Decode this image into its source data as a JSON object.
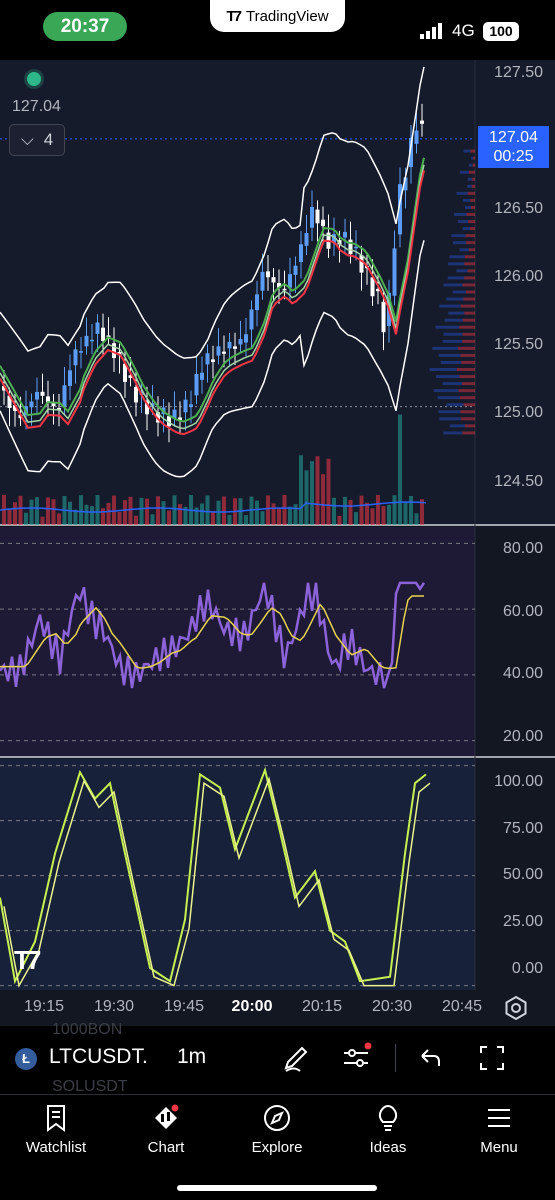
{
  "status_bar": {
    "time": "20:37",
    "app_name": "TradingView",
    "network": "4G",
    "battery": "100"
  },
  "overlay": {
    "last_value": "127.04",
    "indicator_toggle_count": "4",
    "price_tag": {
      "price": "127.04",
      "countdown": "00:25"
    }
  },
  "price_axis": [
    "127.50",
    "127.04",
    "126.50",
    "126.00",
    "125.50",
    "125.00",
    "124.50"
  ],
  "rsi_axis": [
    "80.00",
    "60.00",
    "40.00",
    "20.00"
  ],
  "stoch_axis": [
    "100.00",
    "75.00",
    "50.00",
    "25.00",
    "0.00"
  ],
  "time_axis": [
    "19:15",
    "19:30",
    "19:45",
    "20:00",
    "20:15",
    "20:30",
    "20:45"
  ],
  "toolbar": {
    "symbol": "LTCUSDT.P",
    "symbol_visible": "LTCUSDT.",
    "interval": "1m",
    "ghost_rows": [
      "1000BON",
      "SOLUSDT"
    ]
  },
  "tabs": [
    "Watchlist",
    "Chart",
    "Explore",
    "Ideas",
    "Menu"
  ],
  "colors": {
    "accent": "#2962ff",
    "up": "#5b9cf6",
    "down": "#ffffff",
    "rsi": "#8c63d9",
    "rsi_ma": "#e8d44d",
    "stoch_k": "#c6f050",
    "stoch_d": "#eaf48a",
    "status_pill": "#3aa757"
  },
  "chart_data": {
    "type": "line",
    "price_pane": {
      "ylim": [
        124.3,
        127.6
      ],
      "last_price": 127.04
    },
    "rsi_pane": {
      "ylim": [
        15,
        85
      ],
      "levels": [
        80,
        60,
        40,
        20
      ]
    },
    "stoch_pane": {
      "ylim": [
        -2,
        103
      ],
      "levels": [
        100,
        75,
        50,
        25,
        0
      ]
    },
    "x": [
      "19:15",
      "19:30",
      "19:45",
      "20:00",
      "20:15",
      "20:30",
      "20:45"
    ]
  }
}
